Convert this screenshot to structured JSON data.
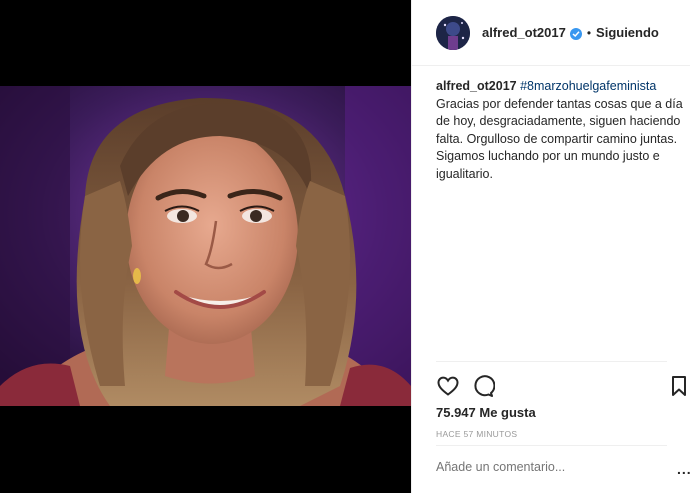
{
  "post": {
    "username": "alfred_ot2017",
    "separator": "•",
    "follow_status": "Siguiendo",
    "caption_user": "alfred_ot2017",
    "hashtag": "#8marzohuelgafeminista",
    "caption_text": "Gracias por defender tantas cosas que a día de hoy, desgraciadamente, siguen haciendo falta. Orgulloso de compartir camino juntas. Sigamos luchando por un mundo justo e igualitario.",
    "likes": "75.947 Me gusta",
    "timestamp": "HACE 57 MINUTOS",
    "comment_placeholder": "Añade un comentario...",
    "more_options": "..."
  },
  "icons": {
    "like": "heart-icon",
    "comment": "comment-bubble-icon",
    "save": "bookmark-icon",
    "verified": "verified-badge-icon"
  },
  "colors": {
    "text": "#262626",
    "muted": "#999999",
    "hashtag": "#003569",
    "verified": "#3897f0",
    "divider": "#efefef"
  }
}
